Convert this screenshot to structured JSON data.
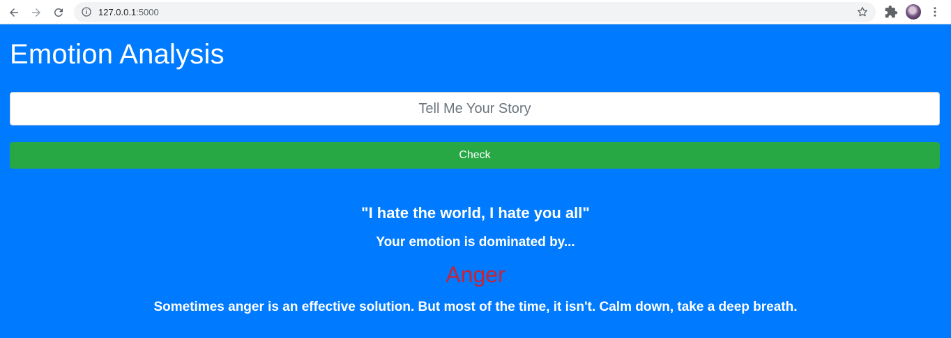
{
  "browser": {
    "url_host": "127.0.0.1",
    "url_port": ":5000"
  },
  "page": {
    "title": "Emotion Analysis",
    "input_placeholder": "Tell Me Your Story",
    "check_label": "Check"
  },
  "result": {
    "quote": "\"I hate the world, I hate you all\"",
    "dominated_text": "Your emotion is dominated by...",
    "emotion": "Anger",
    "emotion_color": "#c82333",
    "advice": "Sometimes anger is an effective solution. But most of the time, it isn't. Calm down, take a deep breath."
  },
  "colors": {
    "background": "#007bff",
    "button": "#28a745"
  },
  "icons": [
    "back-icon",
    "forward-icon",
    "reload-icon",
    "info-icon",
    "star-icon",
    "extensions-icon",
    "profile-avatar",
    "menu-icon"
  ]
}
